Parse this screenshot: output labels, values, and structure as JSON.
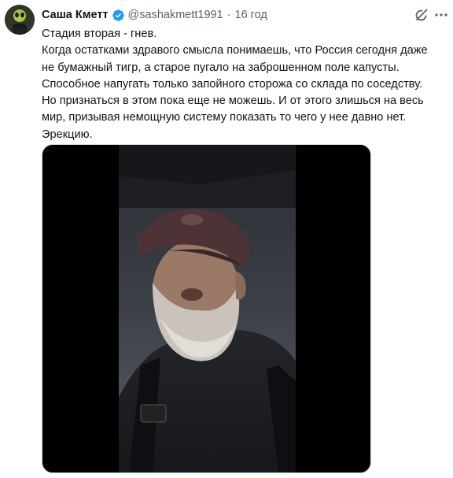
{
  "author": {
    "display_name": "Саша Кметт",
    "handle": "@sashakmett1991",
    "separator": "·",
    "timestamp": "16 год",
    "verified": true
  },
  "icons": {
    "verified": "verified-badge-icon",
    "grok": "grok-icon",
    "more": "more-options-icon"
  },
  "tweet": {
    "lines": [
      "Стадия вторая - гнев.",
      "Когда остатками здравого смысла понимаешь, что Россия сегодня даже",
      "не бумажный тигр, а старое пугало на заброшенном поле капусты.",
      "Способное напугать только запойного сторожа со склада по соседству.",
      "Но признаться в этом пока еще не можешь. И от этого злишься на весь",
      "мир, призывая немощную систему показать то чего у нее давно нет.",
      "Эрекцию."
    ]
  },
  "colors": {
    "text": "#0f1419",
    "secondary": "#536471",
    "verified": "#1d9bf0",
    "media_border": "#cfd9de"
  }
}
